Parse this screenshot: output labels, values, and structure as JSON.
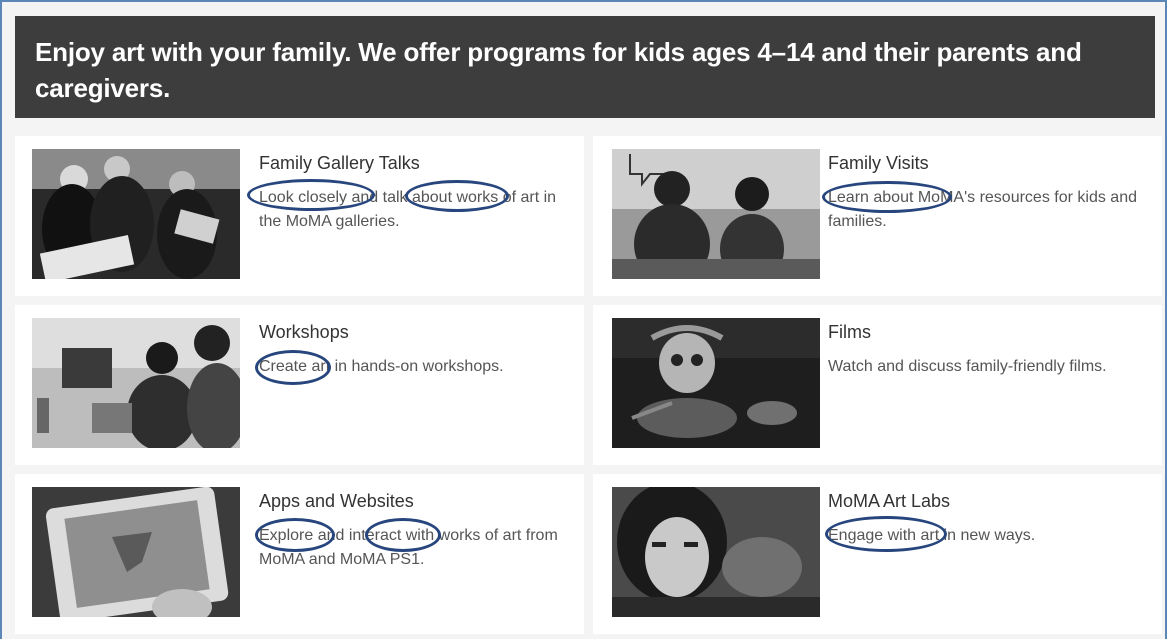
{
  "banner": {
    "text": "Enjoy art with your family. We offer programs for kids ages 4–14 and their parents and caregivers."
  },
  "programs": [
    {
      "title": "Family Gallery Talks",
      "description": "Look closely and talk about works of art in the MoMA galleries."
    },
    {
      "title": "Family Visits",
      "description": "Learn about MoMA's resources for kids and families."
    },
    {
      "title": "Workshops",
      "description": "Create art in hands-on workshops."
    },
    {
      "title": "Films",
      "description": "Watch and discuss family-friendly films."
    },
    {
      "title": "Apps and Websites",
      "description": "Explore and interact with works of art from MoMA and MoMA PS1."
    },
    {
      "title": "MoMA Art Labs",
      "description": "Engage with art in new ways."
    }
  ],
  "colors": {
    "banner_bg": "#3d3d3d",
    "annotation_oval": "#28467e",
    "frame_border": "#5b86b8"
  }
}
